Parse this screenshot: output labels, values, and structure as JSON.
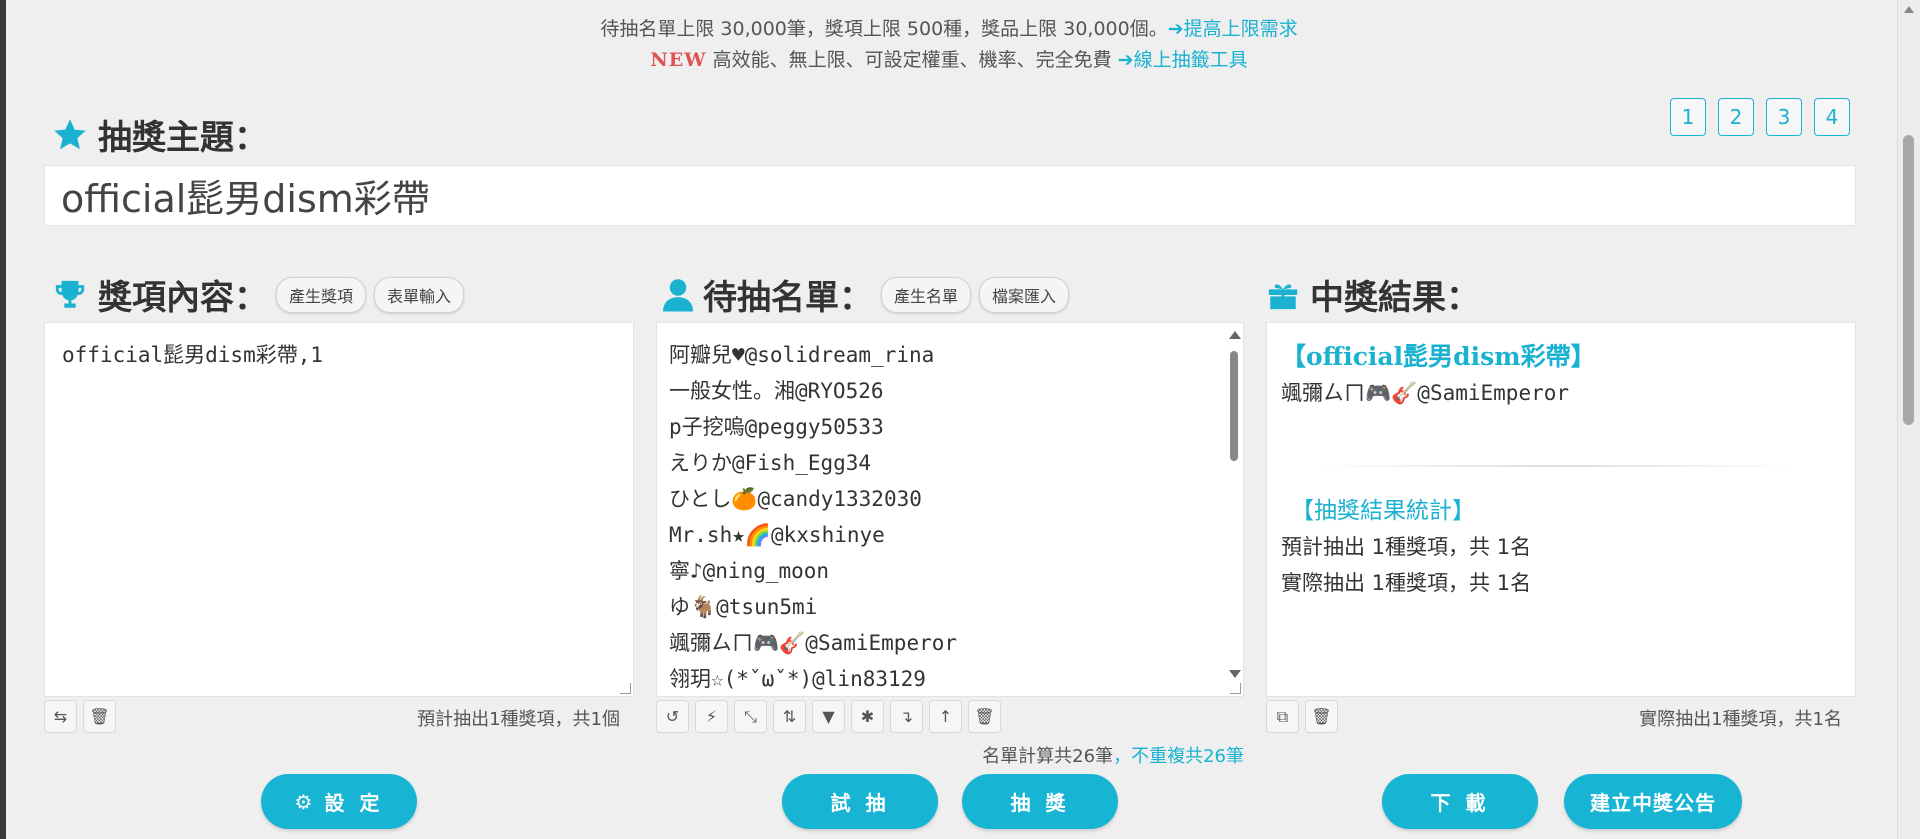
{
  "notice": {
    "line1_text": "待抽名單上限 30,000筆，獎項上限 500種，獎品上限 30,000個。",
    "line1_link": "➔提高上限需求",
    "line2_new": "NEW",
    "line2_text": "高效能、無上限、可設定權重、機率、完全免費 ",
    "line2_link": "➔線上抽籤工具"
  },
  "pages": [
    "1",
    "2",
    "3",
    "4"
  ],
  "theme": {
    "label": "抽獎主題：",
    "value": "official髭男dism彩帶"
  },
  "prizes": {
    "label": "獎項內容：",
    "btn_generate": "產生獎項",
    "btn_form": "表單輸入",
    "content": "official髭男dism彩帶,1",
    "count": "預計抽出1種獎項，共1個"
  },
  "entrants": {
    "label": "待抽名單：",
    "btn_generate": "產生名單",
    "btn_import": "檔案匯入",
    "items": [
      "阿瓣兒♥@solidream_rina",
      "一般女性。湘@RYO526",
      "p子挖嗚@peggy50533",
      "えりか@Fish_Egg34",
      "ひとし🍊@candy1332030",
      "Mr.sh★🌈@kxshinye",
      "寧♪@ning_moon",
      "ゆ🐐@tsun5mi",
      "颯彌ㄙㄇ🎮🎸@SamiEmperor",
      "翎玥☆(*ˇωˇ*)@lin83129"
    ],
    "count_total": "名單計算共26筆",
    "count_unique": "，不重複共26筆"
  },
  "results": {
    "label": "中獎結果：",
    "prize_title": "【official髭男dism彩帶】",
    "winner": "颯彌ㄙㄇ🎮🎸@SamiEmperor",
    "stats_title": "【抽獎結果統計】",
    "stats_expected": "預計抽出 1種獎項，共 1名",
    "stats_actual": "實際抽出 1種獎項，共 1名",
    "count": "實際抽出1種獎項，共1名"
  },
  "buttons": {
    "settings": "設 定",
    "trial": "試 抽",
    "draw": "抽 獎",
    "download": "下 載",
    "announce": "建立中獎公告"
  },
  "colors": {
    "accent": "#17b5d3",
    "new_badge": "#e05353",
    "background": "#efefef"
  }
}
